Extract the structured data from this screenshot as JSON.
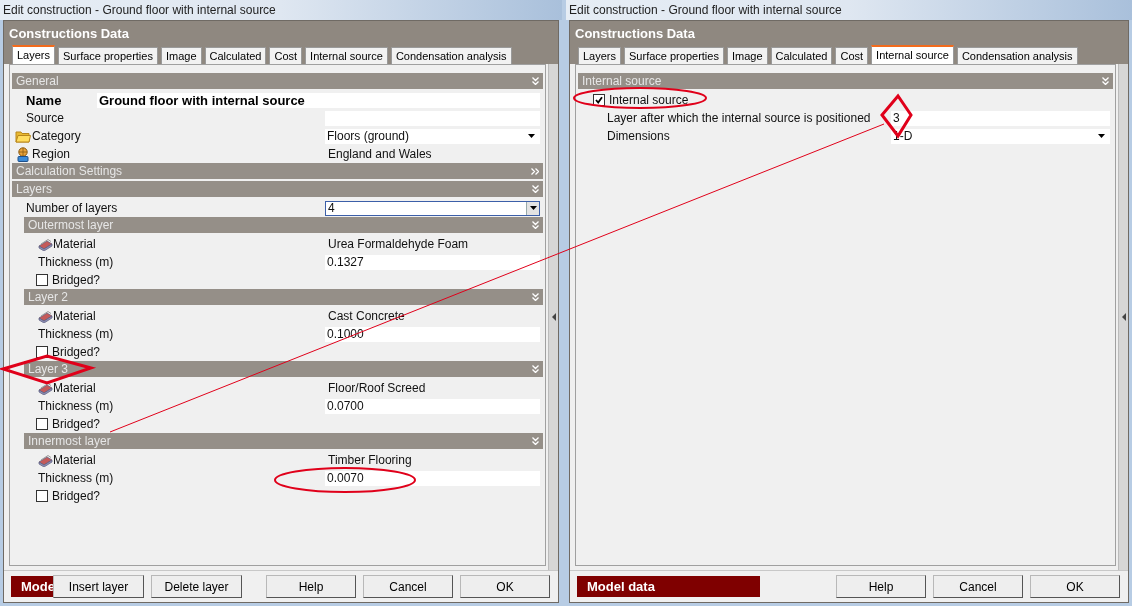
{
  "windows": [
    {
      "title": "Edit construction - Ground floor with internal source",
      "panel_title": "Constructions Data",
      "tabs": [
        {
          "label": "Layers",
          "selected": true
        },
        {
          "label": "Surface properties",
          "selected": false
        },
        {
          "label": "Image",
          "selected": false
        },
        {
          "label": "Calculated",
          "selected": false
        },
        {
          "label": "Cost",
          "selected": false
        },
        {
          "label": "Internal source",
          "selected": false
        },
        {
          "label": "Condensation analysis",
          "selected": false
        }
      ],
      "sections": [
        {
          "title": "General",
          "expanded": true,
          "rows": [
            {
              "kind": "title-field",
              "label": "Name",
              "value": "Ground floor with internal source"
            },
            {
              "kind": "field",
              "label": "Source"
            },
            {
              "kind": "folder-dropdown",
              "label": "Category",
              "value": "Floors (ground)",
              "focused": false
            },
            {
              "kind": "region",
              "label": "Region",
              "value": "England and Wales"
            }
          ]
        },
        {
          "title": "Calculation Settings",
          "expanded": false
        },
        {
          "title": "Layers",
          "expanded": true,
          "rows": [
            {
              "kind": "dropdown",
              "label": "Number of layers",
              "value": "4",
              "focused": true
            }
          ],
          "children": [
            {
              "title": "Outermost layer",
              "expanded": true,
              "rows": [
                {
                  "kind": "material",
                  "label": "Material",
                  "value": "Urea Formaldehyde Foam"
                },
                {
                  "kind": "field",
                  "label": "Thickness (m)",
                  "value": "0.1327"
                },
                {
                  "kind": "checkbox",
                  "label": "Bridged?",
                  "checked": false
                }
              ]
            },
            {
              "title": "Layer 2",
              "expanded": true,
              "rows": [
                {
                  "kind": "material",
                  "label": "Material",
                  "value": "Cast Concrete"
                },
                {
                  "kind": "field",
                  "label": "Thickness (m)",
                  "value": "0.1000"
                },
                {
                  "kind": "checkbox",
                  "label": "Bridged?",
                  "checked": false
                }
              ]
            },
            {
              "title": "Layer 3",
              "expanded": true,
              "rows": [
                {
                  "kind": "material",
                  "label": "Material",
                  "value": "Floor/Roof Screed"
                },
                {
                  "kind": "field",
                  "label": "Thickness (m)",
                  "value": "0.0700"
                },
                {
                  "kind": "checkbox",
                  "label": "Bridged?",
                  "checked": false
                }
              ]
            },
            {
              "title": "Innermost layer",
              "expanded": true,
              "rows": [
                {
                  "kind": "material",
                  "label": "Material",
                  "value": "Timber Flooring"
                },
                {
                  "kind": "field",
                  "label": "Thickness (m)",
                  "value": "0.0070"
                },
                {
                  "kind": "checkbox",
                  "label": "Bridged?",
                  "checked": false
                }
              ]
            }
          ]
        }
      ],
      "footer": {
        "badge": "Mode",
        "tool_buttons": [
          "Insert layer",
          "Delete layer"
        ],
        "buttons": [
          "Help",
          "Cancel",
          "OK"
        ]
      }
    },
    {
      "title": "Edit construction - Ground floor with internal source",
      "panel_title": "Constructions Data",
      "tabs": [
        {
          "label": "Layers",
          "selected": false
        },
        {
          "label": "Surface properties",
          "selected": false
        },
        {
          "label": "Image",
          "selected": false
        },
        {
          "label": "Calculated",
          "selected": false
        },
        {
          "label": "Cost",
          "selected": false
        },
        {
          "label": "Internal source",
          "selected": true
        },
        {
          "label": "Condensation analysis",
          "selected": false
        }
      ],
      "sections": [
        {
          "title": "Internal source",
          "expanded": true,
          "rows": [
            {
              "kind": "checkbox",
              "label": "Internal source",
              "checked": true
            },
            {
              "kind": "field",
              "label": "Layer after which the internal source is positioned",
              "value": "3"
            },
            {
              "kind": "dropdown",
              "label": "Dimensions",
              "value": "1-D",
              "focused": false
            }
          ]
        }
      ],
      "footer": {
        "badge": "Model data",
        "buttons": [
          "Help",
          "Cancel",
          "OK"
        ]
      }
    }
  ]
}
